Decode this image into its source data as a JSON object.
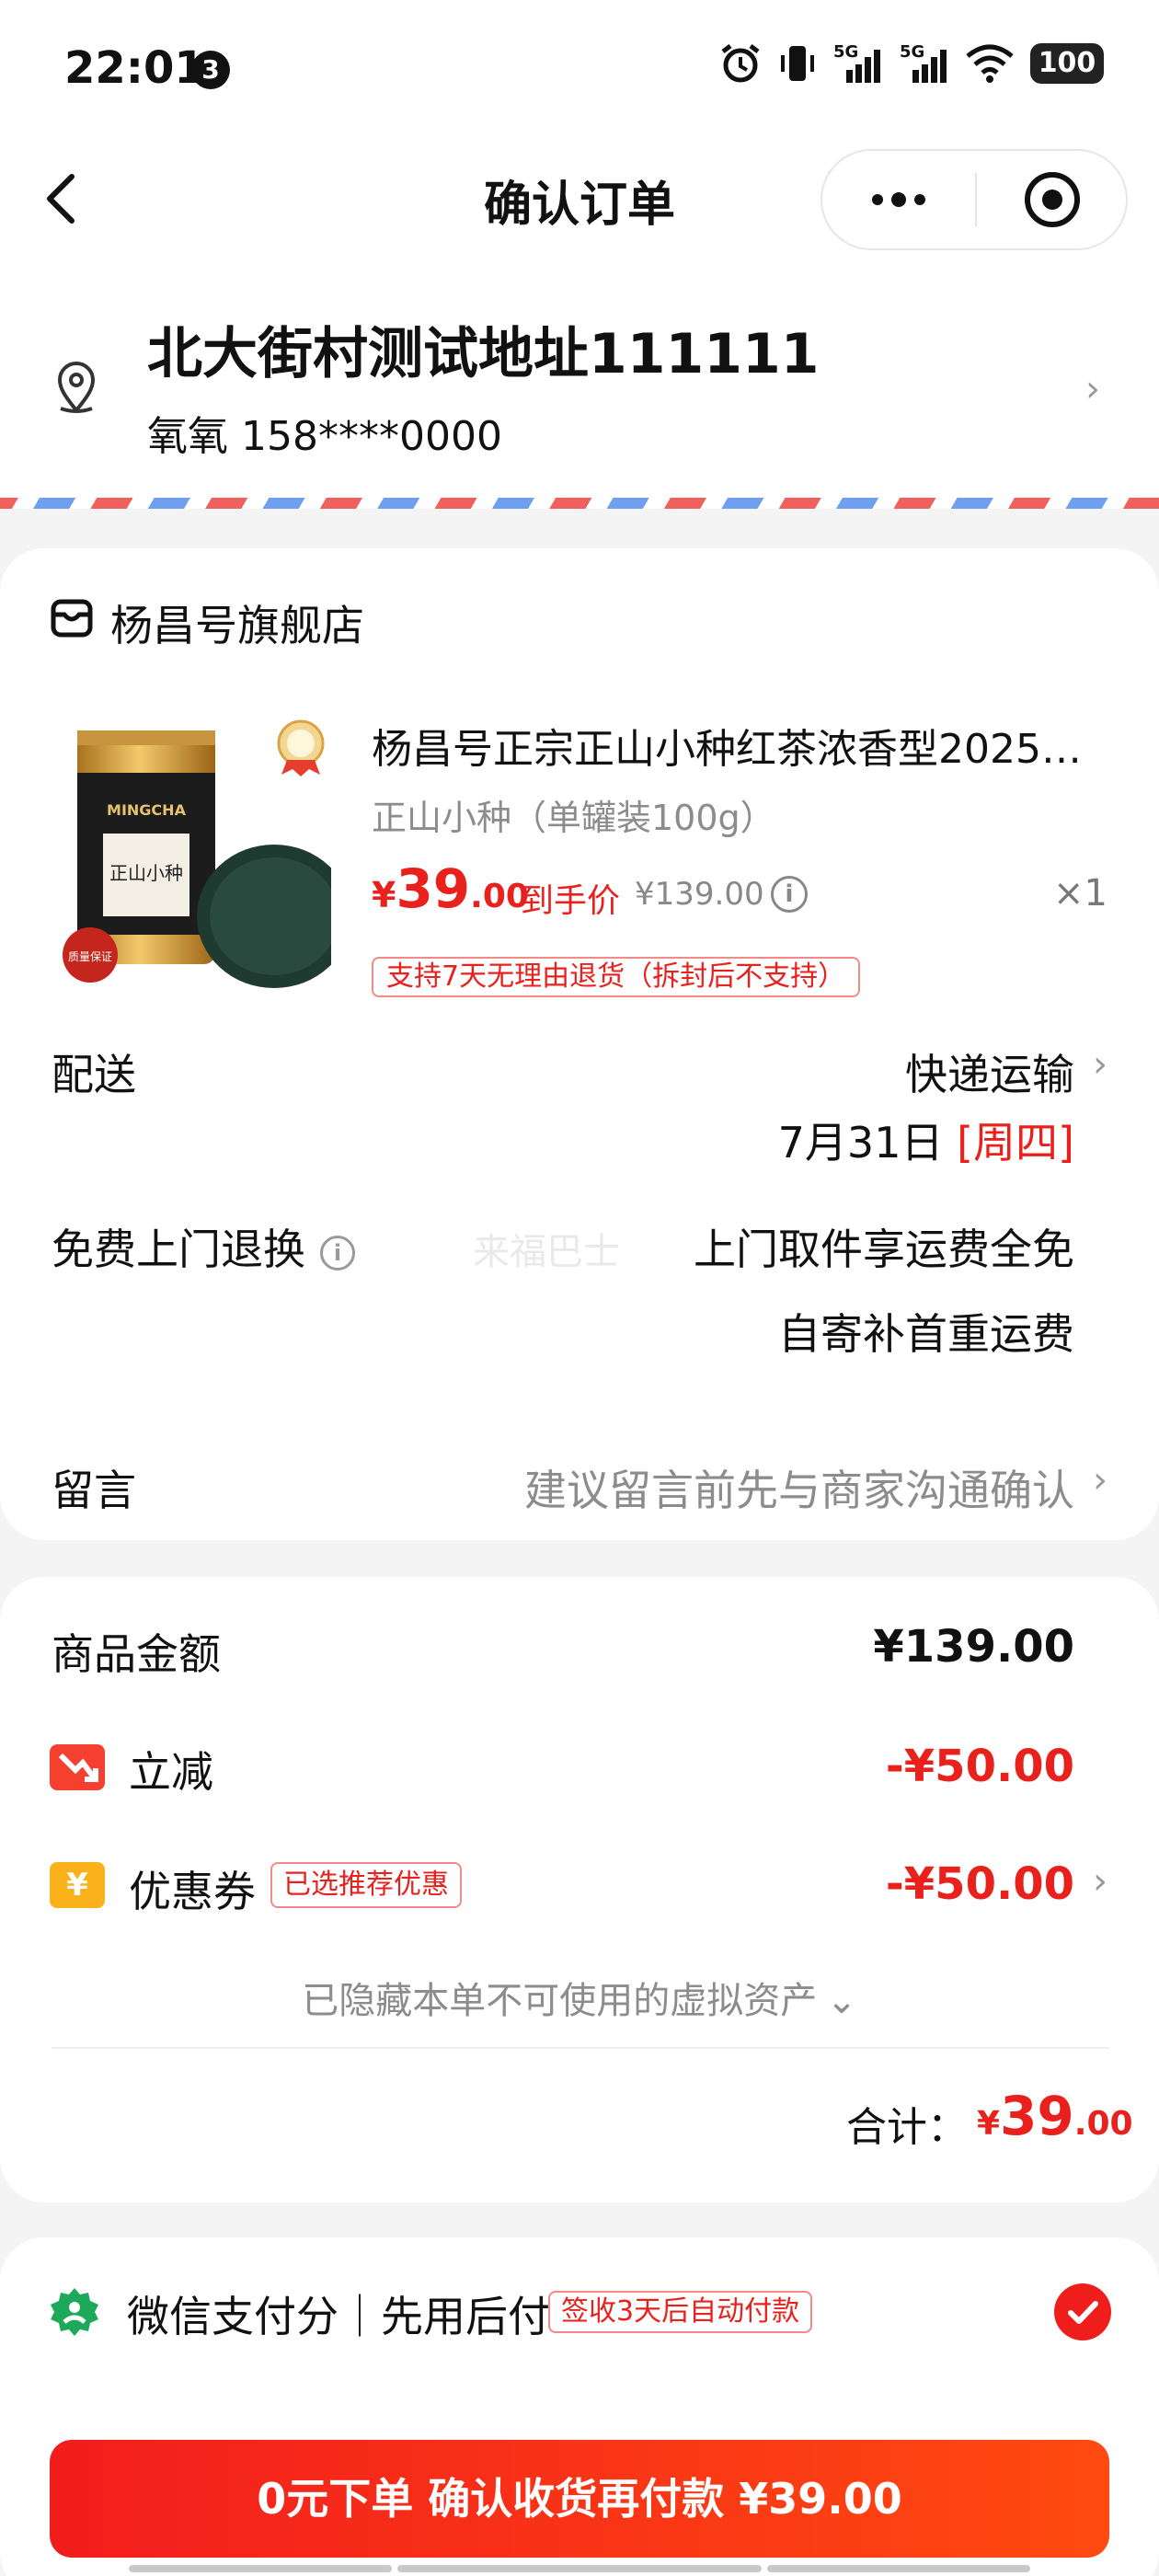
{
  "status_bar": {
    "time": "22:01",
    "badge": "3",
    "network_1": "5G",
    "network_2": "5G",
    "battery": "100"
  },
  "nav": {
    "title": "确认订单"
  },
  "address": {
    "main": "北大街村测试地址111111",
    "contact": "氧氧 158****0000"
  },
  "store": {
    "name": "杨昌号旗舰店"
  },
  "product": {
    "title": "杨昌号正宗正山小种红茶浓香型2025…",
    "spec": "正山小种（单罐装100g）",
    "price_symbol": "¥",
    "price_int": "39",
    "price_dec": ".00",
    "final_label": "到手价",
    "original_price": "¥139.00",
    "quantity": "×1",
    "return_tag": "支持7天无理由退货（拆封后不支持）",
    "image_text": {
      "brand": "MINGCHA",
      "can_label": "正山小种",
      "seal": "质量保证"
    }
  },
  "delivery": {
    "label": "配送",
    "method": "快递运输",
    "date": "7月31日",
    "weekday": "[周四]"
  },
  "free_return": {
    "label": "免费上门退换",
    "line1": "上门取件享运费全免",
    "line2": "自寄补首重运费",
    "watermark": "来福巴士"
  },
  "message": {
    "label": "留言",
    "placeholder": "建议留言前先与商家沟通确认"
  },
  "summary": {
    "goods_label": "商品金额",
    "goods_amount": "¥139.00",
    "discount_label": "立减",
    "discount_amount": "-¥50.00",
    "coupon_label": "优惠券",
    "coupon_tag": "已选推荐优惠",
    "coupon_amount": "-¥50.00",
    "coupon_icon_glyph": "¥",
    "hidden_assets": "已隐藏本单不可使用的虚拟资产",
    "total_label": "合计：",
    "total_symbol": "¥",
    "total_int": "39",
    "total_dec": ".00"
  },
  "payment": {
    "text": "微信支付分｜先用后付",
    "tag": "签收3天后自动付款",
    "selected": true
  },
  "submit": {
    "label": "0元下单 确认收货再付款 ¥39.00"
  },
  "colors": {
    "accent_red": "#e8211d",
    "button_start": "#f21d1d",
    "button_end": "#ff4a10",
    "stripe_red": "#f0605d",
    "stripe_blue": "#6e9ff0"
  }
}
